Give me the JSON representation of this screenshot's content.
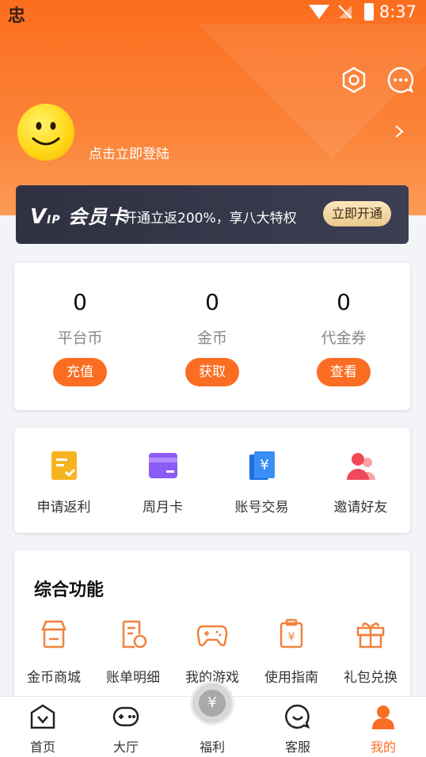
{
  "status_bar": {
    "app_badge": "忠",
    "time": "8:37"
  },
  "header": {
    "settings_icon": "gear-icon",
    "message_icon": "chat-icon",
    "login_text": "点击立即登陆"
  },
  "vip_banner": {
    "logo_v": "V",
    "logo_ip": "IP",
    "logo_card": "会员卡",
    "promo": "开通立返200%，享八大特权",
    "button": "立即开通"
  },
  "wallet": {
    "items": [
      {
        "value": "0",
        "label": "平台币",
        "action": "充值"
      },
      {
        "value": "0",
        "label": "金币",
        "action": "获取"
      },
      {
        "value": "0",
        "label": "代金券",
        "action": "查看"
      }
    ]
  },
  "quick_actions": {
    "items": [
      {
        "label": "申请返利",
        "icon": "rebate-icon"
      },
      {
        "label": "周月卡",
        "icon": "card-icon"
      },
      {
        "label": "账号交易",
        "icon": "trade-icon"
      },
      {
        "label": "邀请好友",
        "icon": "invite-icon"
      }
    ]
  },
  "features": {
    "title": "综合功能",
    "items": [
      {
        "label": "金币商城",
        "icon": "shop-icon"
      },
      {
        "label": "账单明细",
        "icon": "bill-icon"
      },
      {
        "label": "我的游戏",
        "icon": "gamepad-icon"
      },
      {
        "label": "使用指南",
        "icon": "guide-icon"
      },
      {
        "label": "礼包兑换",
        "icon": "gift-icon"
      }
    ]
  },
  "bottom_nav": {
    "items": [
      {
        "label": "首页",
        "icon": "home-icon"
      },
      {
        "label": "大厅",
        "icon": "game-hall-icon"
      },
      {
        "label": "福利",
        "icon": "welfare-icon"
      },
      {
        "label": "客服",
        "icon": "service-icon"
      },
      {
        "label": "我的",
        "icon": "profile-icon"
      }
    ],
    "active_index": 4
  },
  "colors": {
    "accent": "#fb6d22",
    "vip_bg": "#33354a",
    "vip_button": "#f4dba6"
  }
}
